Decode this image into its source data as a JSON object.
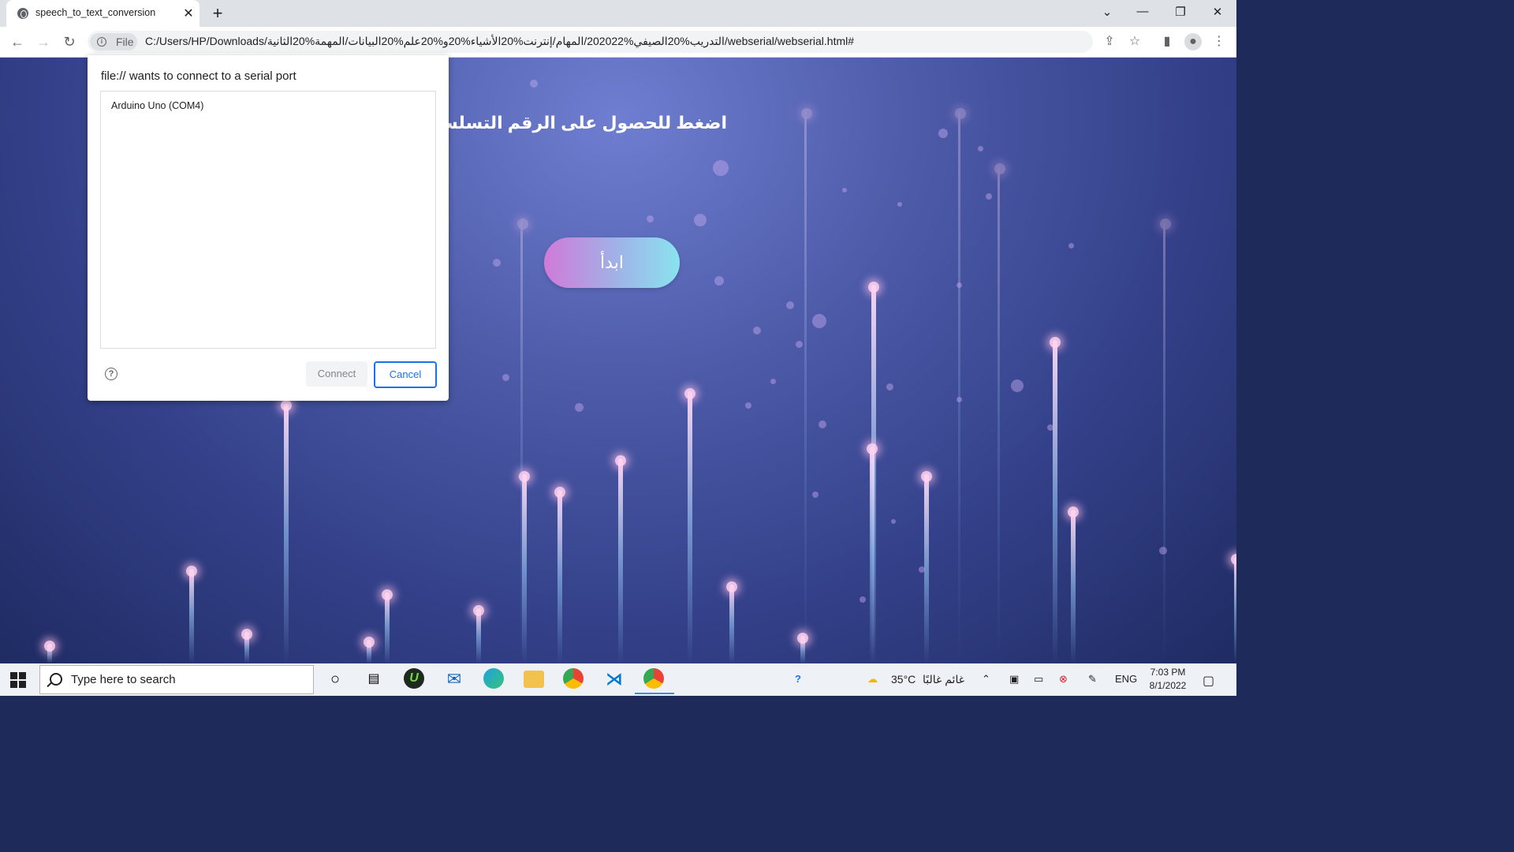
{
  "browser": {
    "tab_title": "speech_to_text_conversion",
    "tab_close": "✕",
    "new_tab": "+",
    "window_controls": {
      "tabsearch": "⌄",
      "minimize": "—",
      "restore": "❐",
      "close": "✕"
    },
    "address": {
      "chip_label": "File",
      "url": "C:/Users/HP/Downloads/التدريب%20الصيفي%202022/المهام/إنترنت%20الأشياء%20و%20علم%20البيانات/المهمة%20الثانية/webserial/webserial.html#"
    },
    "icons": [
      "back-arrow-icon",
      "forward-arrow-icon",
      "reload-icon",
      "share-icon",
      "star-icon",
      "side-panel-icon",
      "profile-icon",
      "kebab-menu-icon"
    ]
  },
  "page": {
    "heading": "اضغط للحصول على الرقم التسلسلي",
    "start_button": "ابدأ"
  },
  "dialog": {
    "title": "file:// wants to connect to a serial port",
    "ports": [
      "Arduino Uno (COM4)"
    ],
    "connect_label": "Connect",
    "cancel_label": "Cancel",
    "help_glyph": "?"
  },
  "taskbar": {
    "search_placeholder": "Type here to search",
    "weather_temp": "35°C",
    "weather_desc": "غائم غالبًا",
    "language": "ENG",
    "time": "7:03 PM",
    "date": "8/1/2022",
    "apps": [
      "cortana-icon",
      "task-view-icon",
      "upwork-icon",
      "mail-icon",
      "edge-icon",
      "file-explorer-icon",
      "chrome-icon",
      "vscode-icon",
      "chrome-active-icon"
    ]
  }
}
